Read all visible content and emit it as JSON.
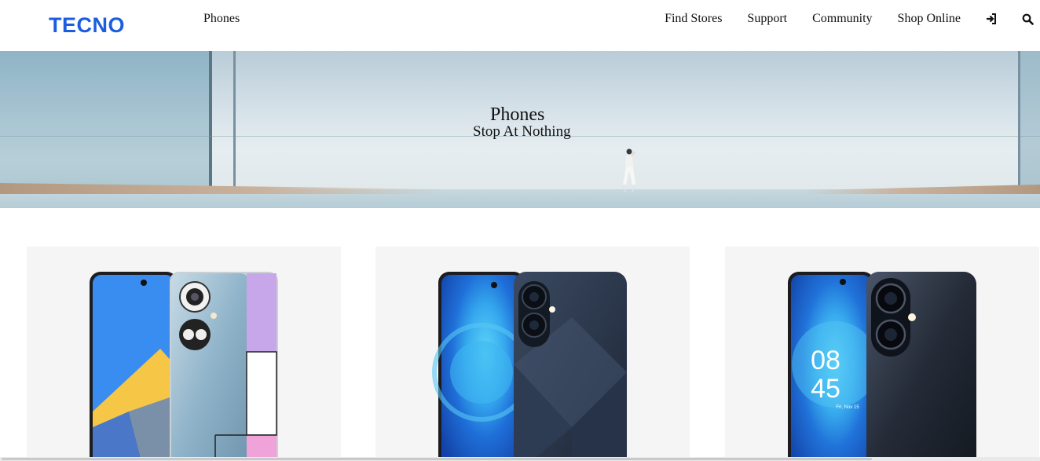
{
  "header": {
    "logo_text": "TECNO",
    "nav_left": "Phones",
    "nav_right": [
      {
        "label": "Find Stores"
      },
      {
        "label": "Support"
      },
      {
        "label": "Community"
      },
      {
        "label": "Shop Online"
      }
    ],
    "icons": [
      "login-icon",
      "search-icon"
    ]
  },
  "hero": {
    "title": "Phones",
    "subtitle": "Stop At Nothing"
  },
  "products": [
    {
      "icon": "phone-image",
      "accent": "#3a8df0"
    },
    {
      "icon": "phone-image",
      "accent": "#2d6fd6"
    },
    {
      "icon": "phone-image",
      "accent": "#2a7be0"
    }
  ],
  "product_clock": {
    "hours": "08",
    "minutes": "45",
    "date": "Fri, Nov 15"
  },
  "colors": {
    "brand_blue": "#1b5de0",
    "text": "#111111"
  }
}
